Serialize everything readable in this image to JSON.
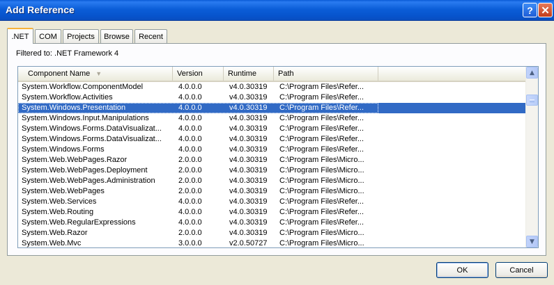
{
  "window": {
    "title": "Add Reference",
    "help_glyph": "?",
    "close_glyph": "✕"
  },
  "tabs": [
    {
      "label": ".NET",
      "active": true
    },
    {
      "label": "COM",
      "active": false
    },
    {
      "label": "Projects",
      "active": false
    },
    {
      "label": "Browse",
      "active": false
    },
    {
      "label": "Recent",
      "active": false
    }
  ],
  "filter_text": "Filtered to: .NET Framework 4",
  "columns": [
    "Component Name",
    "Version",
    "Runtime",
    "Path"
  ],
  "sort_glyph": "▼",
  "rows": [
    {
      "name": "System.Workflow.ComponentModel",
      "version": "4.0.0.0",
      "runtime": "v4.0.30319",
      "path": "C:\\Program Files\\Refer..."
    },
    {
      "name": "System.Workflow.Activities",
      "version": "4.0.0.0",
      "runtime": "v4.0.30319",
      "path": "C:\\Program Files\\Refer..."
    },
    {
      "name": "System.Windows.Presentation",
      "version": "4.0.0.0",
      "runtime": "v4.0.30319",
      "path": "C:\\Program Files\\Refer...",
      "selected": true
    },
    {
      "name": "System.Windows.Input.Manipulations",
      "version": "4.0.0.0",
      "runtime": "v4.0.30319",
      "path": "C:\\Program Files\\Refer..."
    },
    {
      "name": "System.Windows.Forms.DataVisualizat...",
      "version": "4.0.0.0",
      "runtime": "v4.0.30319",
      "path": "C:\\Program Files\\Refer..."
    },
    {
      "name": "System.Windows.Forms.DataVisualizat...",
      "version": "4.0.0.0",
      "runtime": "v4.0.30319",
      "path": "C:\\Program Files\\Refer..."
    },
    {
      "name": "System.Windows.Forms",
      "version": "4.0.0.0",
      "runtime": "v4.0.30319",
      "path": "C:\\Program Files\\Refer..."
    },
    {
      "name": "System.Web.WebPages.Razor",
      "version": "2.0.0.0",
      "runtime": "v4.0.30319",
      "path": "C:\\Program Files\\Micro..."
    },
    {
      "name": "System.Web.WebPages.Deployment",
      "version": "2.0.0.0",
      "runtime": "v4.0.30319",
      "path": "C:\\Program Files\\Micro..."
    },
    {
      "name": "System.Web.WebPages.Administration",
      "version": "2.0.0.0",
      "runtime": "v4.0.30319",
      "path": "C:\\Program Files\\Micro..."
    },
    {
      "name": "System.Web.WebPages",
      "version": "2.0.0.0",
      "runtime": "v4.0.30319",
      "path": "C:\\Program Files\\Micro..."
    },
    {
      "name": "System.Web.Services",
      "version": "4.0.0.0",
      "runtime": "v4.0.30319",
      "path": "C:\\Program Files\\Refer..."
    },
    {
      "name": "System.Web.Routing",
      "version": "4.0.0.0",
      "runtime": "v4.0.30319",
      "path": "C:\\Program Files\\Refer..."
    },
    {
      "name": "System.Web.RegularExpressions",
      "version": "4.0.0.0",
      "runtime": "v4.0.30319",
      "path": "C:\\Program Files\\Refer..."
    },
    {
      "name": "System.Web.Razor",
      "version": "2.0.0.0",
      "runtime": "v4.0.30319",
      "path": "C:\\Program Files\\Micro..."
    },
    {
      "name": "System.Web.Mvc",
      "version": "3.0.0.0",
      "runtime": "v2.0.50727",
      "path": "C:\\Program Files\\Micro..."
    }
  ],
  "scrollbar": {
    "up_glyph": "▲",
    "down_glyph": "▼"
  },
  "buttons": {
    "ok": "OK",
    "cancel": "Cancel"
  },
  "colors": {
    "selection": "#316ac5",
    "title_bar": "#0a5bd6",
    "active_tab_accent": "#f6b23a"
  }
}
